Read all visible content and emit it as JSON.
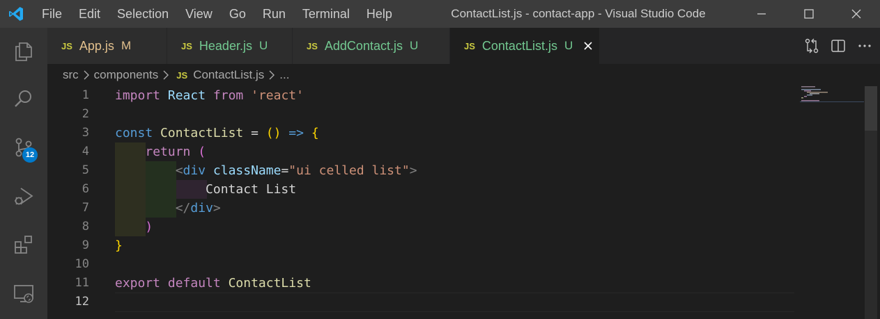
{
  "window": {
    "title": "ContactList.js - contact-app - Visual Studio Code"
  },
  "menu": [
    "File",
    "Edit",
    "Selection",
    "View",
    "Go",
    "Run",
    "Terminal",
    "Help"
  ],
  "activity_bar": {
    "items": [
      "explorer-icon",
      "search-icon",
      "source-control-icon",
      "run-debug-icon",
      "extensions-icon",
      "remote-explorer-icon"
    ],
    "source_control_badge": "12"
  },
  "tabs": [
    {
      "badge": "JS",
      "label": "App.js",
      "status": "M",
      "color": "#e2c08d"
    },
    {
      "badge": "JS",
      "label": "Header.js",
      "status": "U",
      "color": "#73c991"
    },
    {
      "badge": "JS",
      "label": "AddContact.js",
      "status": "U",
      "color": "#73c991"
    },
    {
      "badge": "JS",
      "label": "ContactList.js",
      "status": "U",
      "color": "#73c991",
      "active": true
    }
  ],
  "breadcrumb": {
    "parts": [
      "src",
      "components"
    ],
    "file_badge": "JS",
    "file": "ContactList.js",
    "ellipsis": "..."
  },
  "editor": {
    "current_line": 12,
    "lines": [
      {
        "n": "1",
        "tokens": [
          [
            "import",
            "kw"
          ],
          [
            " ",
            "plain"
          ],
          [
            "React",
            "var"
          ],
          [
            " ",
            "plain"
          ],
          [
            "from",
            "kw"
          ],
          [
            " ",
            "plain"
          ],
          [
            "'react'",
            "str"
          ]
        ]
      },
      {
        "n": "2",
        "tokens": []
      },
      {
        "n": "3",
        "tokens": [
          [
            "const",
            "kw2"
          ],
          [
            " ",
            "plain"
          ],
          [
            "ContactList",
            "def"
          ],
          [
            " = ",
            "plain"
          ],
          [
            "()",
            "br1"
          ],
          [
            " ",
            "plain"
          ],
          [
            "=>",
            "kw2"
          ],
          [
            " ",
            "plain"
          ],
          [
            "{",
            "br1"
          ]
        ]
      },
      {
        "n": "4",
        "tokens": [
          [
            "    ",
            "plain"
          ],
          [
            "return",
            "kw"
          ],
          [
            " ",
            "plain"
          ],
          [
            "(",
            "br2"
          ]
        ]
      },
      {
        "n": "5",
        "tokens": [
          [
            "        ",
            "plain"
          ],
          [
            "<",
            "tagp"
          ],
          [
            "div",
            "tag"
          ],
          [
            " ",
            "plain"
          ],
          [
            "className",
            "attr"
          ],
          [
            "=",
            "plain"
          ],
          [
            "\"ui celled list\"",
            "str"
          ],
          [
            ">",
            "tagp"
          ]
        ]
      },
      {
        "n": "6",
        "tokens": [
          [
            "            ",
            "plain"
          ],
          [
            "Contact List",
            "plain"
          ]
        ]
      },
      {
        "n": "7",
        "tokens": [
          [
            "        ",
            "plain"
          ],
          [
            "</",
            "tagp"
          ],
          [
            "div",
            "tag"
          ],
          [
            ">",
            "tagp"
          ]
        ]
      },
      {
        "n": "8",
        "tokens": [
          [
            "    ",
            "plain"
          ],
          [
            ")",
            "br2"
          ]
        ]
      },
      {
        "n": "9",
        "tokens": [
          [
            "}",
            "br1"
          ]
        ]
      },
      {
        "n": "10",
        "tokens": []
      },
      {
        "n": "11",
        "tokens": [
          [
            "export",
            "kw"
          ],
          [
            " ",
            "plain"
          ],
          [
            "default",
            "kw"
          ],
          [
            " ",
            "plain"
          ],
          [
            "ContactList",
            "def"
          ]
        ]
      },
      {
        "n": "12",
        "tokens": []
      }
    ]
  }
}
